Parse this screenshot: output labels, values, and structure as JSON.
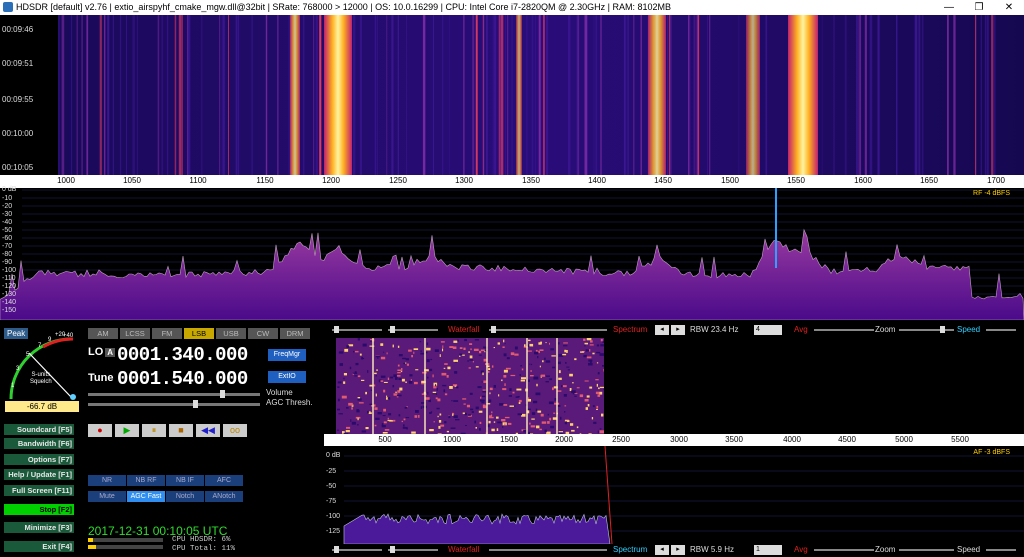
{
  "titlebar": {
    "title": "HDSDR  [default]  v2.76   |  extio_airspyhf_cmake_mgw.dll@32bit  | SRate: 768000 > 12000  | OS: 10.0.16299   | CPU: Intel Core i7-2820QM @ 2.30GHz  | RAM: 8102MB",
    "minimize": "—",
    "restore": "❐",
    "close": "✕"
  },
  "waterfall": {
    "times": [
      "00:09:46",
      "00:09:51",
      "00:09:55",
      "00:10:00",
      "00:10:05"
    ]
  },
  "freq_axis": {
    "labels": [
      "1000",
      "1050",
      "1100",
      "1150",
      "1200",
      "1250",
      "1300",
      "1350",
      "1400",
      "1450",
      "1500",
      "1550",
      "1600",
      "1650",
      "1700"
    ]
  },
  "rf_spectrum": {
    "ylabels": [
      "0 dB",
      "-10",
      "-20",
      "-30",
      "-40",
      "-50",
      "-60",
      "-70",
      "-80",
      "-90",
      "-100",
      "-110",
      "-120",
      "-130",
      "-140",
      "-150"
    ],
    "readout": "RF  -4 dBFS"
  },
  "smeter": {
    "peak": "Peak",
    "scale": [
      "1",
      "3",
      "5",
      "7",
      "9",
      "+20",
      "+40"
    ],
    "label": "S-units\nSquelch",
    "value": "-66.7 dB"
  },
  "modes": [
    "AM",
    "LCSS",
    "FM",
    "LSB",
    "USB",
    "CW",
    "DRM"
  ],
  "selected_mode": "LSB",
  "lo": {
    "label": "LO",
    "a_label": "A",
    "value": "0001.340.000"
  },
  "tune": {
    "label": "Tune",
    "value": "0001.540.000"
  },
  "buttons": {
    "freqmgr": "FreqMgr",
    "extio": "ExtIO"
  },
  "sliders": {
    "volume": "Volume",
    "agc": "AGC Thresh."
  },
  "transport": [
    "●",
    "▶",
    "⏸",
    "■",
    "◀◀",
    "oo"
  ],
  "sidebar": [
    {
      "label": "Soundcard  [F5]",
      "active": false
    },
    {
      "label": "Bandwidth  [F6]",
      "active": false
    },
    {
      "label": "Options  [F7]",
      "active": false
    },
    {
      "label": "Help / Update  [F1]",
      "active": false
    },
    {
      "label": "Full Screen  [F11]",
      "active": false
    },
    {
      "label": "Stop  [F2]",
      "active": true
    },
    {
      "label": "Minimize  [F3]",
      "active": false
    },
    {
      "label": "Exit  [F4]",
      "active": false
    }
  ],
  "dsp": {
    "row1": [
      {
        "label": "NR",
        "on": false
      },
      {
        "label": "NB RF",
        "on": false
      },
      {
        "label": "NB IF",
        "on": false
      },
      {
        "label": "AFC",
        "on": false
      }
    ],
    "row2": [
      {
        "label": "Mute",
        "on": false
      },
      {
        "label": "AGC Fast",
        "on": true
      },
      {
        "label": "Notch",
        "on": false
      },
      {
        "label": "ANotch",
        "on": false
      }
    ]
  },
  "clock": "2017-12-31  00:10:05 UTC",
  "cpu": {
    "hdsdr": "CPU HDSDR:  6%",
    "total": "CPU Total: 11%"
  },
  "top_ctrl": {
    "waterfall": "Waterfall",
    "spectrum": "Spectrum",
    "rbw": "RBW 23.4 Hz",
    "rbw_sel": "4",
    "avg": "Avg",
    "zoom": "Zoom",
    "speed": "Speed"
  },
  "bottom_ctrl": {
    "waterfall": "Waterfall",
    "spectrum": "Spectrum",
    "rbw": "RBW  5.9 Hz",
    "rbw_sel": "1",
    "avg": "Avg",
    "zoom": "Zoom",
    "speed": "Speed"
  },
  "audio_axis": {
    "labels": [
      "500",
      "1000",
      "1500",
      "2000",
      "2500",
      "3000",
      "3500",
      "4000",
      "4500",
      "5000",
      "5500"
    ]
  },
  "af_spectrum": {
    "ylabels": [
      "0 dB",
      "-25",
      "-50",
      "-75",
      "-100",
      "-125"
    ],
    "readout": "AF  -3 dBFS"
  },
  "colors": {
    "accent": "#2f8ef0",
    "waterfall_hot": "#ffe060",
    "spectrum_fill": "#6a1a9a"
  }
}
